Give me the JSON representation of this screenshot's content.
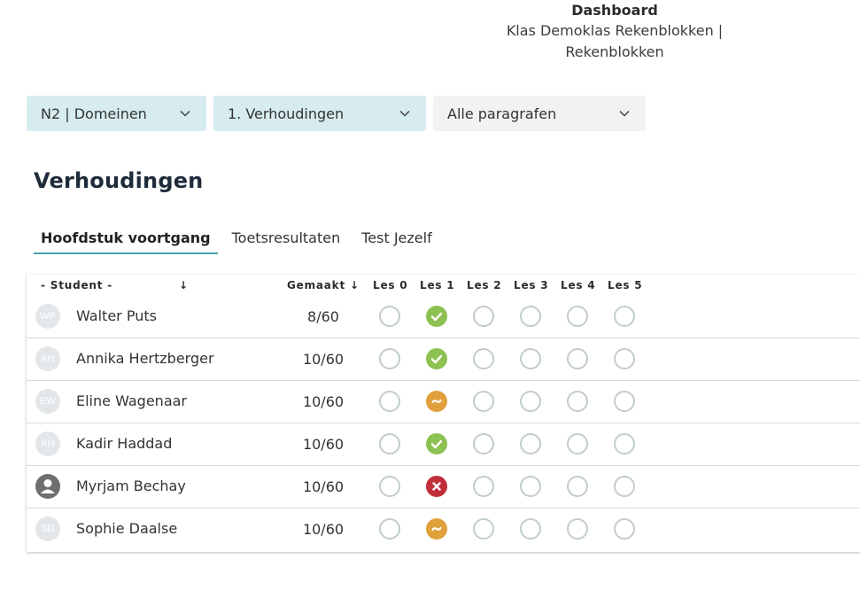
{
  "header": {
    "title": "Dashboard",
    "subtitle": "Klas Demoklas Rekenblokken | Rekenblokken"
  },
  "filters": {
    "domain": "N2 | Domeinen",
    "chapter": "1. Verhoudingen",
    "paragraph": "Alle paragrafen"
  },
  "page_title": "Verhoudingen",
  "tabs": [
    {
      "label": "Hoofdstuk voortgang",
      "active": true
    },
    {
      "label": "Toetsresultaten",
      "active": false
    },
    {
      "label": "Test Jezelf",
      "active": false
    }
  ],
  "table": {
    "headers": {
      "student": "- Student -",
      "student_sort": "↓",
      "made": "Gemaakt ↓",
      "lessons": [
        "Les 0",
        "Les 1",
        "Les 2",
        "Les 3",
        "Les 4",
        "Les 5"
      ]
    },
    "rows": [
      {
        "initials": "WP",
        "name": "Walter Puts",
        "made": "8/60",
        "avatar": "initials",
        "lessons": [
          "empty",
          "done",
          "empty",
          "empty",
          "empty",
          "empty"
        ]
      },
      {
        "initials": "AH",
        "name": "Annika Hertzberger",
        "made": "10/60",
        "avatar": "initials",
        "lessons": [
          "empty",
          "done",
          "empty",
          "empty",
          "empty",
          "empty"
        ]
      },
      {
        "initials": "EW",
        "name": "Eline Wagenaar",
        "made": "10/60",
        "avatar": "initials",
        "lessons": [
          "empty",
          "partial",
          "empty",
          "empty",
          "empty",
          "empty"
        ]
      },
      {
        "initials": "KH",
        "name": "Kadir Haddad",
        "made": "10/60",
        "avatar": "initials",
        "lessons": [
          "empty",
          "done",
          "empty",
          "empty",
          "empty",
          "empty"
        ]
      },
      {
        "initials": "",
        "name": "Myrjam Bechay",
        "made": "10/60",
        "avatar": "photo",
        "lessons": [
          "empty",
          "fail",
          "empty",
          "empty",
          "empty",
          "empty"
        ]
      },
      {
        "initials": "SD",
        "name": "Sophie Daalse",
        "made": "10/60",
        "avatar": "initials",
        "lessons": [
          "empty",
          "partial",
          "empty",
          "empty",
          "empty",
          "empty"
        ]
      }
    ]
  },
  "colors": {
    "accent_teal": "#4aa3a8",
    "select_teal_bg": "#d6ecef",
    "done": "#8dc152",
    "partial": "#e0a03c",
    "fail": "#c02f3a"
  }
}
